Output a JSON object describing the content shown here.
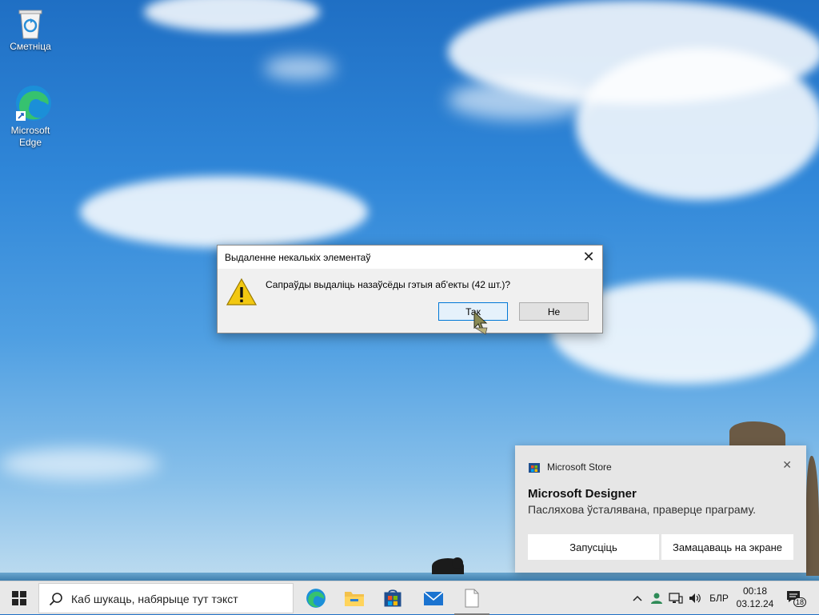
{
  "desktop": {
    "icons": [
      {
        "label": "Сметніца",
        "icon": "recycle-bin-icon"
      },
      {
        "label": "Microsoft Edge",
        "icon": "edge-icon"
      }
    ]
  },
  "dialog": {
    "title": "Выдаленне некалькіх элементаў",
    "message": "Сапраўды выдаліць назаўсёды гэтыя аб'екты (42 шт.)?",
    "yes_label": "Так",
    "no_label": "Не",
    "close_glyph": "✕"
  },
  "toast": {
    "app_name": "Microsoft Store",
    "heading": "Microsoft Designer",
    "body": "Пасляхова ўсталявана, праверце праграму.",
    "launch_label": "Запусціць",
    "pin_label": "Замацаваць на экране",
    "close_glyph": "✕"
  },
  "taskbar": {
    "search_placeholder": "Каб шукаць, набярыце тут тэкст",
    "apps": [
      "edge-icon",
      "file-explorer-icon",
      "store-icon",
      "mail-icon",
      "notepad-icon"
    ],
    "tray": {
      "chevron": "^",
      "language": "БЛР",
      "time": "00:18",
      "date": "03.12.24",
      "notification_count": "18"
    }
  },
  "colors": {
    "accent": "#0078d7",
    "warning": "#f2c811"
  }
}
